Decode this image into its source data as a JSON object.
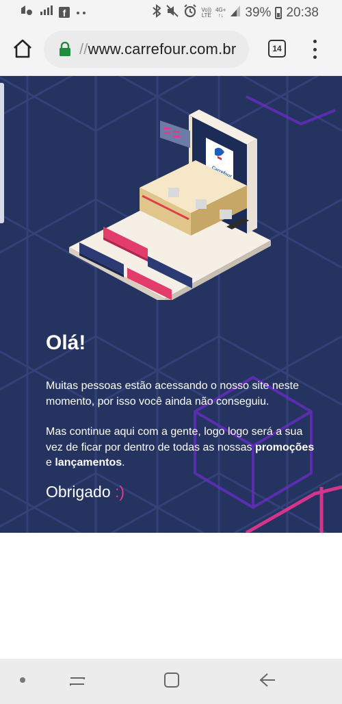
{
  "status_bar": {
    "net_label_top": "Vo))",
    "net_label_bottom": "LTE",
    "signal_label_top": "4G+",
    "signal_label_bottom": "↑↓",
    "battery": "39%",
    "time": "20:38"
  },
  "browser": {
    "url_prefix": "//",
    "url_domain": "www.carrefour.com.br",
    "tab_count": "14"
  },
  "page": {
    "heading": "Olá!",
    "paragraph1": "Muitas pessoas estão acessando o nosso site neste momento, por isso você ainda não conseguiu.",
    "paragraph2_start": "Mas continue aqui com a gente, logo logo será a sua vez de ficar por dentro de todas as nossas",
    "promo_word": "promoções",
    "conjunction": "e",
    "launch_word": "lançamentos",
    "period": ".",
    "thanks": "Obrigado",
    "smiley": ":)",
    "logo_text": "Carrefour"
  },
  "colors": {
    "background": "#253361",
    "accent": "#e8368f",
    "grid_lines": "#3b4a8a"
  }
}
